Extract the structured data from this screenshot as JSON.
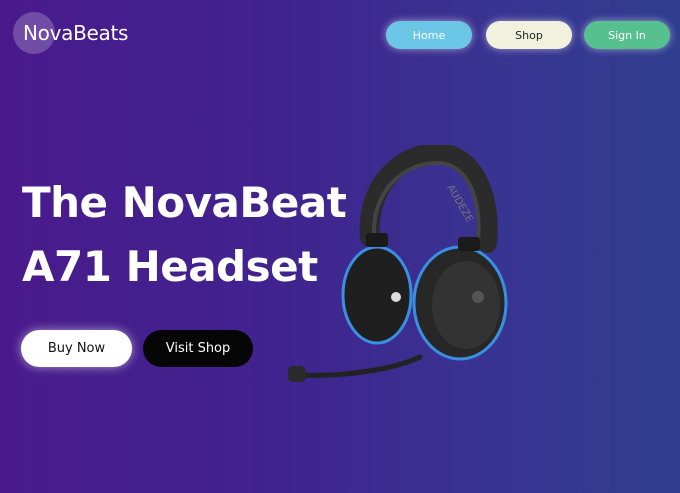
{
  "brand": {
    "name": "NovaBeats"
  },
  "nav": {
    "home": "Home",
    "shop": "Shop",
    "sign_in": "Sign In"
  },
  "hero": {
    "title_line1": "The NovaBeat",
    "title_line2": "A71 Headset",
    "buy_label": "Buy Now",
    "visit_label": "Visit Shop"
  },
  "product_image": {
    "name": "headset-image",
    "band_text": "AUDEZE"
  },
  "colors": {
    "home_button": "#6cc6e6",
    "shop_button": "#f1f1dd",
    "signin_button": "#57c08f",
    "accent_ring": "#3a8fe0"
  }
}
